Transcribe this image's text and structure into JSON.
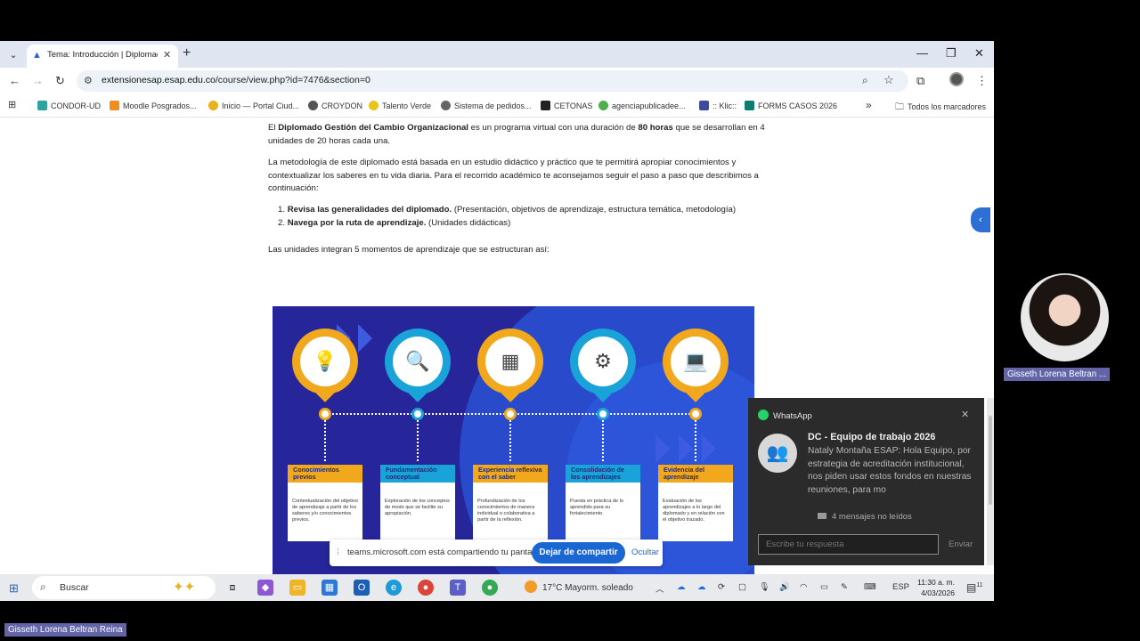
{
  "browser": {
    "tab_title": "Tema: Introducción | Diplomado",
    "url_host": "extensionesap.esap.edu.co",
    "url_path": "/course/view.php?id=7476&section=0",
    "bookmarks": [
      "CONDOR-UD",
      "Moodle Posgrados...",
      "Inicio — Portal Ciud...",
      "CROYDON",
      "Talento Verde",
      "Sistema de pedidos...",
      "CETONAS",
      "agenciapublicadee...",
      ":: Klic::",
      "FORMS CASOS 2026"
    ],
    "bookmarks_overflow": "»",
    "all_bookmarks": "Todos los marcadores"
  },
  "content": {
    "intro_prefix": "El ",
    "intro_bold": "Diplomado Gestión del Cambio Organizacional",
    "intro_mid": " es un programa virtual con una duración de ",
    "intro_hours": "80 horas",
    "intro_suffix": " que se desarrollan en 4 unidades de 20 horas cada una.",
    "methodology": "La metodología de este diplomado está basada en un estudio didáctico y práctico que te permitirá apropiar conocimientos y contextualizar los saberes en tu vida diaria. Para el recorrido académico te aconsejamos seguir el paso a paso que describimos a continuación:",
    "step1_num": "1.",
    "step1_bold": "Revisa las generalidades del diplomado.",
    "step1_rest": " (Presentación, objetivos de aprendizaje, estructura temática, metodología)",
    "step2_num": "2.",
    "step2_bold": "Navega por la ruta de aprendizaje.",
    "step2_rest": " (Unidades didácticas)",
    "units": "Las unidades integran 5 momentos de aprendizaje que se estructuran así:"
  },
  "infographic": {
    "moments": [
      {
        "title": "Conocimientos previos",
        "desc": "Contextualización del objetivo de aprendizaje a partir de los saberes y/o conocimientos previos.",
        "icon": "brain-bulb-icon",
        "color": "#f2a81d"
      },
      {
        "title": "Fundamentación conceptual",
        "desc": "Exploración de los conceptos de modo que se facilite su apropiación.",
        "icon": "magnifier-icon",
        "color": "#1aa3d9"
      },
      {
        "title": "Experiencia reflexiva con el saber",
        "desc": "Profundización de los conocimientos de manera individual o colaborativa a partir de la reflexión.",
        "icon": "diagram-icon",
        "color": "#f2a81d"
      },
      {
        "title": "Consolidación de los aprendizajes",
        "desc": "Puesta en práctica de lo aprendido para su fortalecimiento.",
        "icon": "gears-icon",
        "color": "#1aa3d9"
      },
      {
        "title": "Evidencia del aprendizaje",
        "desc": "Evaluación de los aprendizajes a lo largo del diplomado y en relación con el objetivo trazado.",
        "icon": "laptop-icon",
        "color": "#f2a81d"
      }
    ]
  },
  "sharebar": {
    "text": "teams.microsoft.com está compartiendo tu pantalla.",
    "stop": "Dejar de compartir",
    "hide": "Ocultar"
  },
  "whatsapp": {
    "app": "WhatsApp",
    "group": "DC - Equipo de trabajo 2026",
    "message": "Nataly Montaña ESAP: Hola Equipo, por estrategia de acreditación institucional, nos piden usar estos fondos en nuestras reuniones, para mo",
    "unread": "4 mensajes no leídos",
    "reply_placeholder": "Escribe tu respuesta",
    "send": "Enviar"
  },
  "taskbar": {
    "search": "Buscar",
    "weather": "17°C  Mayorm. soleado",
    "lang": "ESP",
    "time": "11:30 a. m.",
    "date": "4/03/2026",
    "notif_count": "11"
  },
  "meeting": {
    "participant_name": "Gisseth Lorena Beltran ...",
    "presenter_name": "Gisseth Lorena Beltran Reina"
  },
  "colors": {
    "accent_blue": "#1a66d2",
    "teams_purple": "#6264a7",
    "infographic_bg": "#26259a",
    "orange": "#f2a81d",
    "cyan": "#1aa3d9"
  }
}
